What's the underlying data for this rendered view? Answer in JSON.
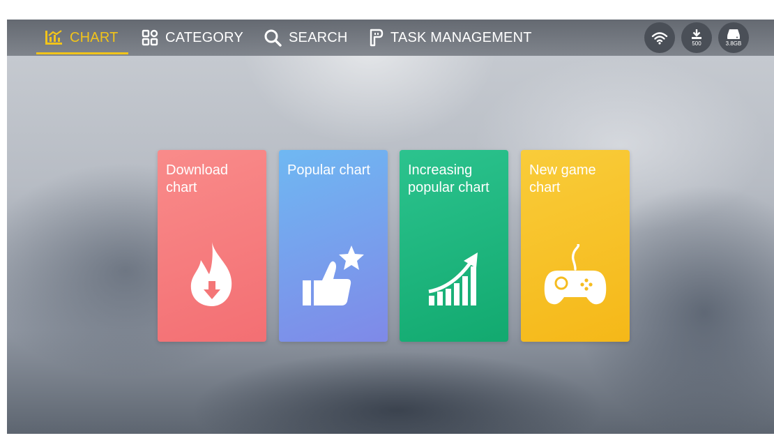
{
  "nav": {
    "items": [
      {
        "label": "CHART",
        "icon": "chart-icon",
        "active": true
      },
      {
        "label": "CATEGORY",
        "icon": "category-grid-icon",
        "active": false
      },
      {
        "label": "SEARCH",
        "icon": "search-icon",
        "active": false
      },
      {
        "label": "TASK MANAGEMENT",
        "icon": "task-management-icon",
        "active": false
      }
    ]
  },
  "status": {
    "wifi_icon": "wifi-icon",
    "downloads_icon": "download-icon",
    "downloads_count": "500",
    "storage_icon": "storage-icon",
    "storage_value": "3.8GB"
  },
  "cards": [
    {
      "title": "Download chart",
      "icon": "fire-download-icon",
      "color": "#f47d7e"
    },
    {
      "title": "Popular chart",
      "icon": "thumbs-up-star-icon",
      "color": "#759fee"
    },
    {
      "title": "Increasing popular chart",
      "icon": "rising-bars-icon",
      "color": "#1cb67e"
    },
    {
      "title": "New game chart",
      "icon": "gamepad-icon",
      "color": "#f7c22a"
    }
  ],
  "colors": {
    "accent": "#f2c41a"
  }
}
